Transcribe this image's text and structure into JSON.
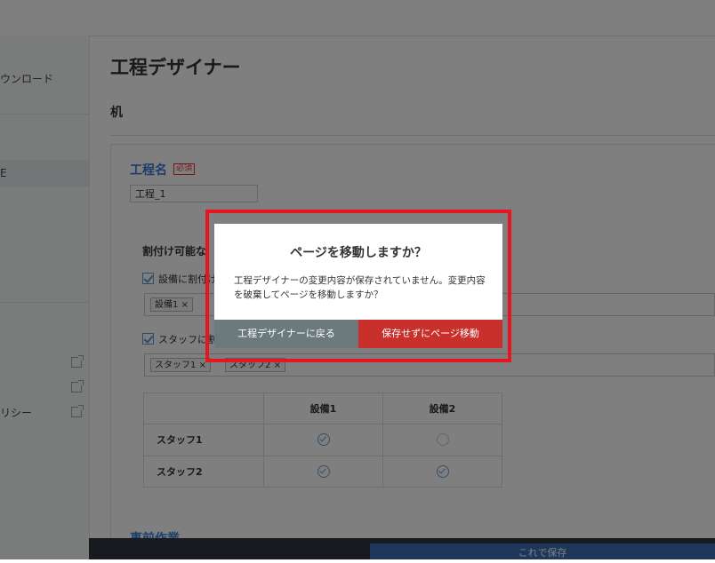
{
  "sidebar": {
    "items": [
      {
        "label": "ウンロード"
      },
      {
        "label": "E"
      },
      {
        "label": "リシー"
      }
    ]
  },
  "page": {
    "title": "工程デザイナー",
    "subtitle": "机"
  },
  "form": {
    "process_name_label": "工程名",
    "required_badge": "必須",
    "process_name_value": "工程_1",
    "section_heading": "割付け可能な",
    "equipment_checkbox_label": "設備に割付け",
    "equipment_tags": [
      "設備1"
    ],
    "staff_checkbox_label": "スタッフに割",
    "staff_tags": [
      "スタッフ1",
      "スタッフ2"
    ],
    "tag_remove_glyph": "×",
    "next_section_title": "事前作業",
    "save_label": "これで保存"
  },
  "matrix": {
    "columns": [
      "設備1",
      "設備2"
    ],
    "rows": [
      {
        "label": "スタッフ1",
        "cells": [
          true,
          false
        ]
      },
      {
        "label": "スタッフ2",
        "cells": [
          true,
          true
        ]
      }
    ]
  },
  "modal": {
    "title": "ページを移動しますか？",
    "message": "工程デザイナーの変更内容が保存されていません。変更内容を破棄してページを移動しますか？",
    "back_label": "工程デザイナーに戻る",
    "leave_label": "保存せずにページ移動"
  },
  "colors": {
    "accent": "#3a7bd5",
    "danger": "#c9302c",
    "secondary_button": "#6c7a7e",
    "highlight_frame": "#e8141e"
  }
}
